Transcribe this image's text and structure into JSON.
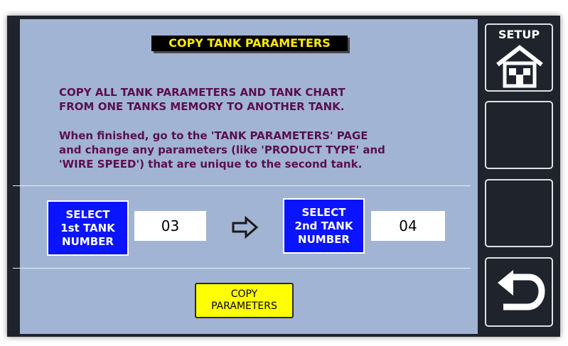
{
  "header": {
    "title": "COPY TANK PARAMETERS"
  },
  "instructions": {
    "line1": "COPY ALL TANK PARAMETERS AND TANK CHART\nFROM ONE TANKS MEMORY TO ANOTHER TANK.",
    "line2": "When finished, go to the 'TANK PARAMETERS' PAGE\nand change any parameters (like 'PRODUCT TYPE' and\n'WIRE SPEED') that are unique to the second tank."
  },
  "selection": {
    "first_button_label": "SELECT\n1st TANK\nNUMBER",
    "first_value": "03",
    "second_button_label": "SELECT\n2nd TANK\nNUMBER",
    "second_value": "04",
    "arrow_icon": "right-arrow-icon"
  },
  "actions": {
    "copy_label": "COPY\nPARAMETERS"
  },
  "sidebar": {
    "setup_label": "SETUP",
    "setup_icon": "house-icon",
    "back_icon": "return-arrow-icon"
  },
  "colors": {
    "panel": "#a2b4d3",
    "title_text": "#ffeb00",
    "instruction_text": "#5a0f4f",
    "select_button": "#0a14ff",
    "copy_button": "#ffff00"
  }
}
